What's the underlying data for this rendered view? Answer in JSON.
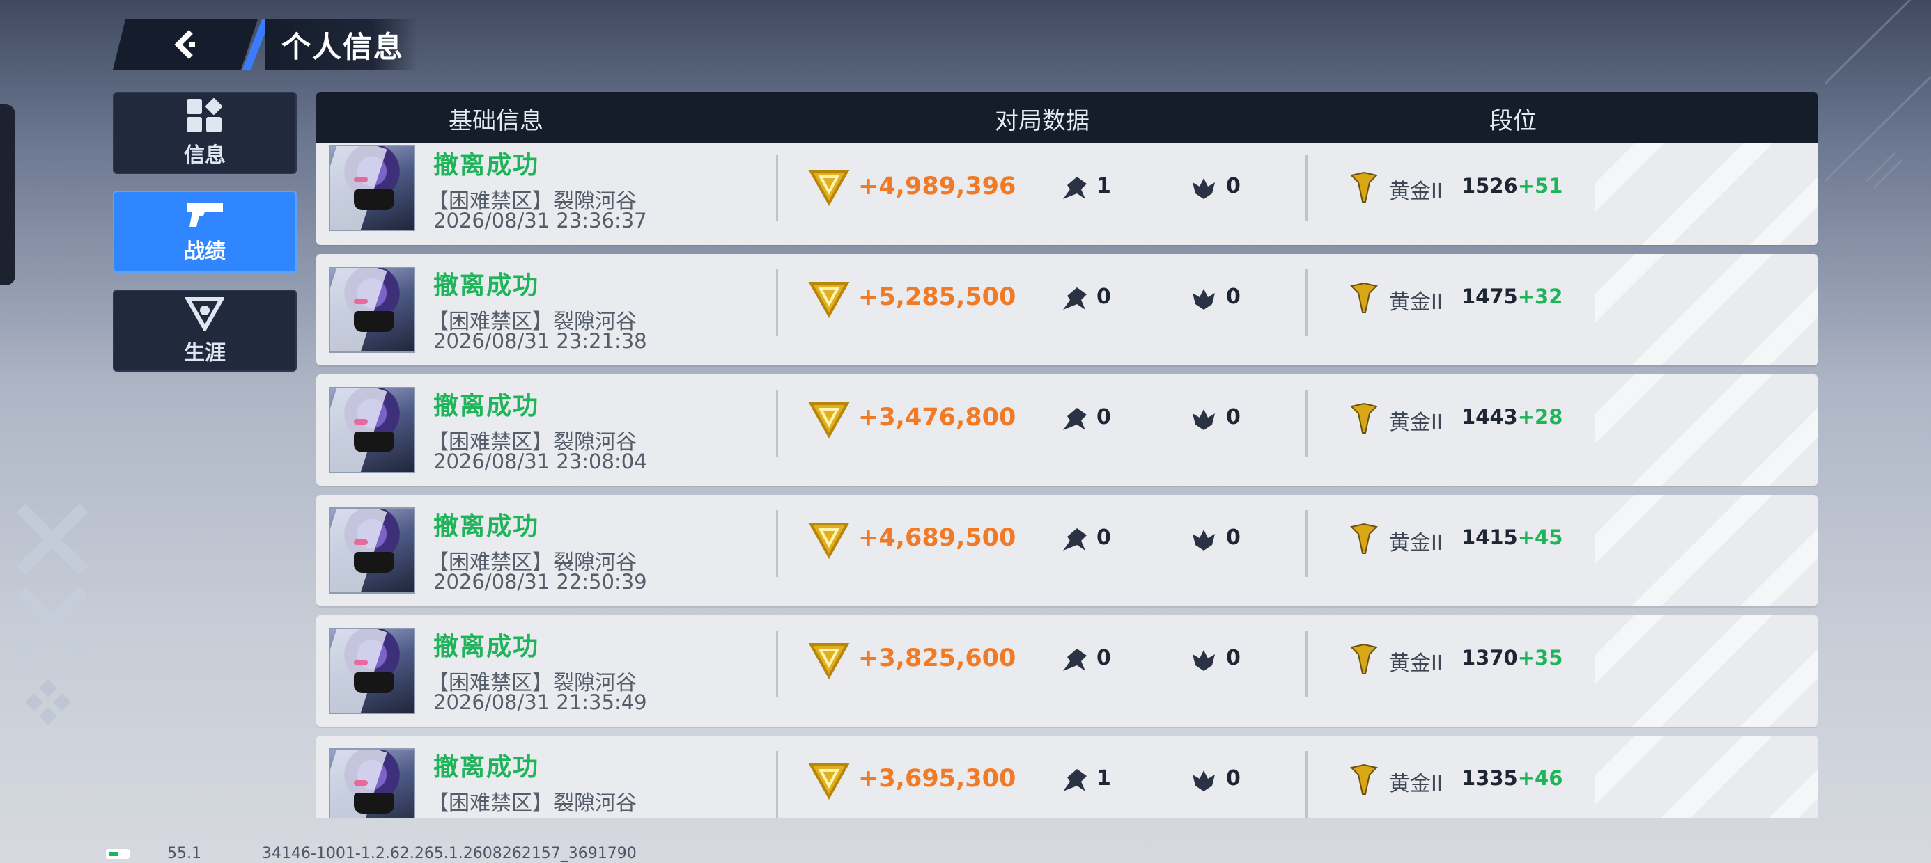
{
  "header_bar": {
    "title": "个人信息"
  },
  "sidebar": {
    "items": [
      {
        "label": "信息",
        "icon": "grid-icon",
        "active": false
      },
      {
        "label": "战绩",
        "icon": "pistol-icon",
        "active": true
      },
      {
        "label": "生涯",
        "icon": "career-icon",
        "active": false
      }
    ]
  },
  "table": {
    "headers": {
      "basic": "基础信息",
      "match": "对局数据",
      "rank": "段位"
    },
    "rows": [
      {
        "status": "撤离成功",
        "mode": "【困难禁区】裂隙河谷",
        "time": "2026/08/31 23:36:37",
        "value": "+4,989,396",
        "kills": "1",
        "knocks": "0",
        "rank": "黄金II",
        "score": "1526",
        "delta": "+51"
      },
      {
        "status": "撤离成功",
        "mode": "【困难禁区】裂隙河谷",
        "time": "2026/08/31 23:21:38",
        "value": "+5,285,500",
        "kills": "0",
        "knocks": "0",
        "rank": "黄金II",
        "score": "1475",
        "delta": "+32"
      },
      {
        "status": "撤离成功",
        "mode": "【困难禁区】裂隙河谷",
        "time": "2026/08/31 23:08:04",
        "value": "+3,476,800",
        "kills": "0",
        "knocks": "0",
        "rank": "黄金II",
        "score": "1443",
        "delta": "+28"
      },
      {
        "status": "撤离成功",
        "mode": "【困难禁区】裂隙河谷",
        "time": "2026/08/31 22:50:39",
        "value": "+4,689,500",
        "kills": "0",
        "knocks": "0",
        "rank": "黄金II",
        "score": "1415",
        "delta": "+45"
      },
      {
        "status": "撤离成功",
        "mode": "【困难禁区】裂隙河谷",
        "time": "2026/08/31 21:35:49",
        "value": "+3,825,600",
        "kills": "0",
        "knocks": "0",
        "rank": "黄金II",
        "score": "1370",
        "delta": "+35"
      },
      {
        "status": "撤离成功",
        "mode": "【困难禁区】裂隙河谷",
        "time": "",
        "value": "+3,695,300",
        "kills": "1",
        "knocks": "0",
        "rank": "黄金II",
        "score": "1335",
        "delta": "+46"
      }
    ]
  },
  "footer": {
    "fps": "55.1",
    "build": "34146-1001-1.2.62.265.1.2608262157_3691790"
  },
  "colors": {
    "accent": "#2f86ff",
    "success": "#1fb35a",
    "value": "#f07a26",
    "gold": "#d9a616"
  }
}
